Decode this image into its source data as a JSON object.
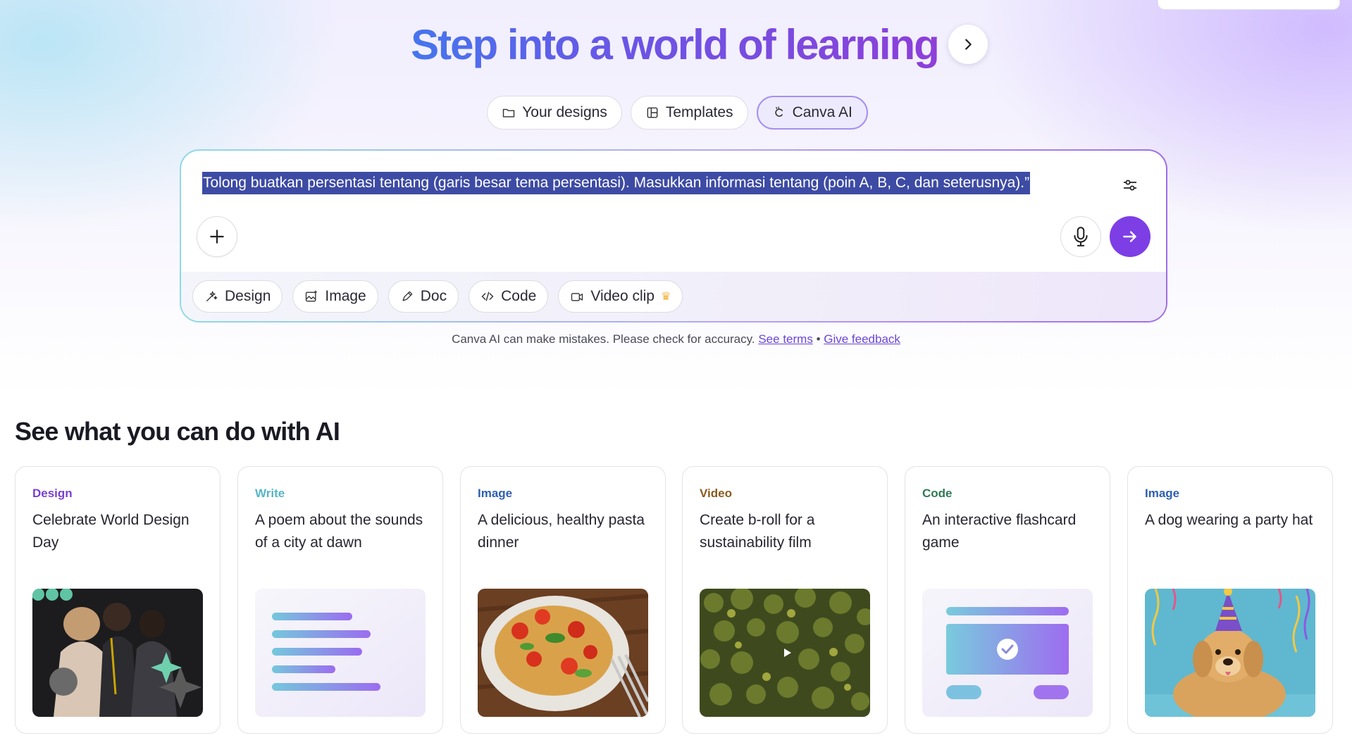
{
  "hero": {
    "title": "Step into a world of learning",
    "arrow_icon": "chevron-right-icon"
  },
  "tabs": [
    {
      "label": "Your designs",
      "icon": "folder-icon",
      "active": false
    },
    {
      "label": "Templates",
      "icon": "template-icon",
      "active": false
    },
    {
      "label": "Canva AI",
      "icon": "canva-ai-icon",
      "active": true
    }
  ],
  "prompt": {
    "text": "Tolong buatkan persentasi tentang (garis besar tema persentasi). Masukkan informasi tentang (poin A, B, C, dan seterusnya).”",
    "settings_icon": "sliders-icon",
    "plus_icon": "plus-icon",
    "mic_icon": "microphone-icon",
    "send_icon": "arrow-right-icon",
    "send_color": "#7d3ee6"
  },
  "chips": [
    {
      "label": "Design",
      "icon": "sparkle-icon"
    },
    {
      "label": "Image",
      "icon": "image-icon"
    },
    {
      "label": "Doc",
      "icon": "pen-icon"
    },
    {
      "label": "Code",
      "icon": "code-icon"
    },
    {
      "label": "Video clip",
      "icon": "video-icon",
      "badge": "♛"
    }
  ],
  "disclaimer": {
    "text": "Canva AI can make mistakes. Please check for accuracy.",
    "terms_link": "See terms",
    "separator": "•",
    "feedback_link": "Give feedback"
  },
  "section": {
    "title": "See what you can do with AI"
  },
  "cards": [
    {
      "category": "Design",
      "category_color": "#7a3fd0",
      "text": "Celebrate World Design Day",
      "media": "design-photo"
    },
    {
      "category": "Write",
      "category_color": "#55b6c9",
      "text": "A poem about the sounds of a city at dawn",
      "media": "text-lines-illustration"
    },
    {
      "category": "Image",
      "category_color": "#2e5fb0",
      "text": "A delicious, healthy pasta dinner",
      "media": "pasta-photo"
    },
    {
      "category": "Video",
      "category_color": "#8a5a1e",
      "text": "Create b-roll for a sustainability film",
      "media": "forest-video"
    },
    {
      "category": "Code",
      "category_color": "#2e7a56",
      "text": "An interactive flashcard game",
      "media": "flashcard-illustration"
    },
    {
      "category": "Image",
      "category_color": "#2e5fb0",
      "text": "A dog wearing a party hat",
      "media": "dog-photo"
    }
  ]
}
